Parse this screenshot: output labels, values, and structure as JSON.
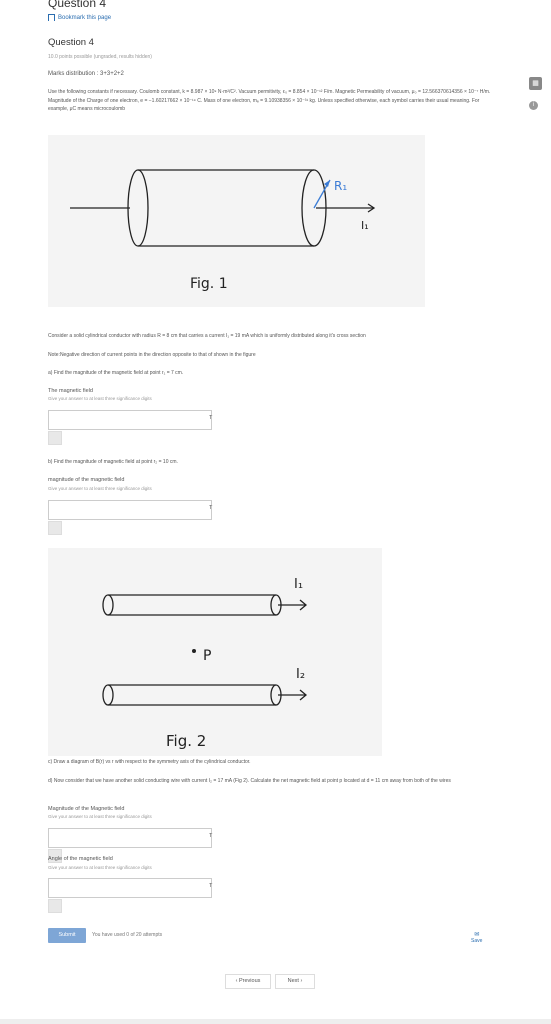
{
  "header": {
    "question_top": "Question 4",
    "bookmark": "Bookmark this page"
  },
  "question": {
    "title": "Question 4",
    "points": "10.0 points possible (ungraded, results hidden)",
    "marks": "Marks distribution : 3+3+2+2",
    "constants": "Use the following constants if necessary. Coulomb constant, k = 8.987 × 10⁹ N·m²/C². Vacuum permitivity, ϵ₀ = 8.854 × 10⁻¹² F/m. Magnetic Permeability of vacuum, μ₀ = 12.566370614356 × 10⁻⁷ H/m. Magnitude of the Charge of one electron, e = −1.60217662 × 10⁻¹⁹ C. Mass of one electron, mₑ = 9.10938356 × 10⁻³¹ kg. Unless specified otherwise, each symbol carries their usual meaning. For example, μC means microcoulomb"
  },
  "fig1": {
    "label": "Fig. 1",
    "r_label": "R₁",
    "i_label": "I₁"
  },
  "text": {
    "consider": "Consider a solid cylindrical conductor with radius R = 8 cm that carries a current I₁ = 19 mA which is uniformly distributed along it's cross section",
    "note": "Note:Negative direction of current points in the direction opposite to that of shown in the figure",
    "part_a": "a) Find the magnitude of the magnetic field at point r₁ = 7 cm.",
    "part_b": "b) Find the magnitude of magnetic field at point r₂ = 10 cm.",
    "part_c": "c) Draw a diagram of B(r) vs r with respect to the symmetry axis of the cylindrical conductor.",
    "part_d": "d) Now consider that we have another solid conducting wire with current I₂ = 17 mA (Fig 2). Calculate the net magnetic field at point p located at d = 11 cm away from both of the wires"
  },
  "fields": {
    "a_label": "The magnetic field",
    "a_hint": "Give your answer to at least three significance digits",
    "a_unit": "T",
    "b_label": "magnitude of the magnetic field",
    "b_hint": "Give your answer to at least three significance digits",
    "b_unit": "T",
    "d1_label": "Magnitude of the Magnetic field",
    "d1_hint": "Give your answer to at least three significance digits",
    "d1_unit": "T",
    "d2_label": "Angle of the magnetic field",
    "d2_hint": "Give your answer to at least three significance digits",
    "d2_unit": "T"
  },
  "fig2": {
    "label": "Fig. 2",
    "i1_label": "I₁",
    "i2_label": "I₂",
    "p_label": "P"
  },
  "footer": {
    "submit": "Submit",
    "attempts": "You have used 0 of 20 attempts",
    "save": "Save",
    "previous": "Previous",
    "next": "Next"
  },
  "colors": {
    "link": "#2a6db0",
    "submit_bg": "#7ea6d6",
    "figure_bg": "#f4f4f4"
  }
}
